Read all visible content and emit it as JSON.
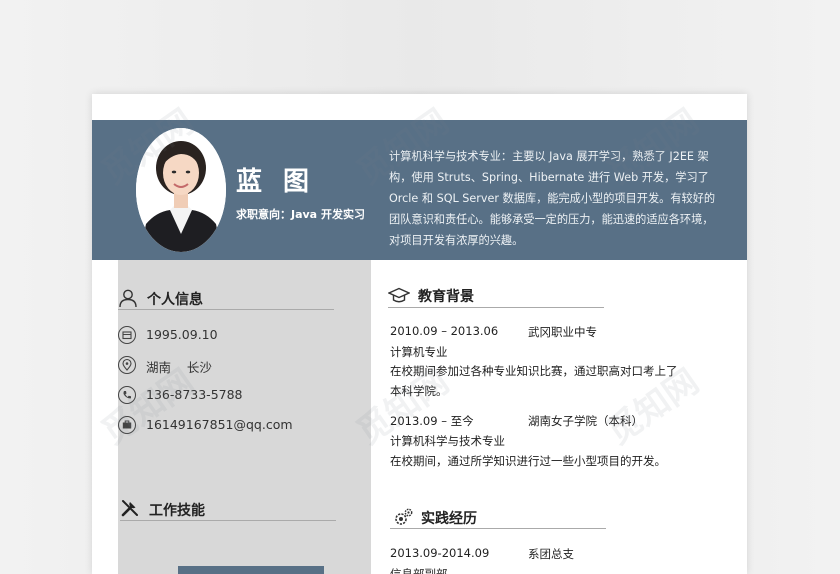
{
  "header": {
    "name": "蓝 图",
    "intention": "求职意向：Java 开发实习",
    "summary": "计算机科学与技术专业：主要以 Java 展开学习，熟悉了 J2EE 架构，使用 Struts、Spring、Hibernate 进行 Web 开发，学习了 Orcle 和 SQL Server 数据库，能完成小型的项目开发。有较好的团队意识和责任心。能够承受一定的压力，能迅速的适应各环境，对项目开发有浓厚的兴趣。"
  },
  "personal": {
    "title": "个人信息",
    "birth": "1995.09.10",
    "location": "湖南    长沙",
    "phone": "136-8733-5788",
    "email": "16149167851@qq.com"
  },
  "skills": {
    "title": "工作技能"
  },
  "education": {
    "title": "教育背景",
    "entries": [
      {
        "period": "2010.09 – 2013.06",
        "school": "武冈职业中专",
        "major": "计算机专业",
        "desc1": "在校期间参加过各种专业知识比赛，通过职高对口考上了",
        "desc2": "本科学院。"
      },
      {
        "period": "2013.09 – 至今",
        "school": "湖南女子学院（本科）",
        "major": "计算机科学与技术专业",
        "desc1": "在校期间，通过所学知识进行过一些小型项目的开发。"
      }
    ]
  },
  "practice": {
    "title": "实践经历",
    "entries": [
      {
        "period": "2013.09-2014.09",
        "role": "系团总支",
        "dept": "信息部副部"
      }
    ]
  },
  "colors": {
    "header_bg": "#587086",
    "left_col_bg": "#d8d8d8"
  },
  "watermark": "觅知网"
}
